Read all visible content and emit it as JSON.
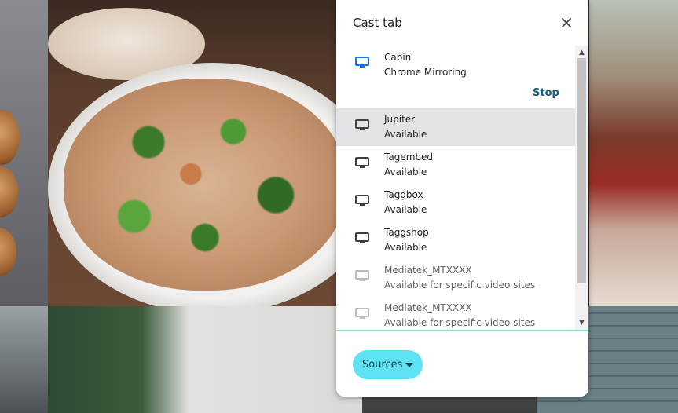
{
  "dialog": {
    "title": "Cast tab",
    "close_icon": "close-icon",
    "active_sink": {
      "name": "Cabin",
      "status": "Chrome Mirroring",
      "icon": "cast-screen-icon",
      "icon_color": "#1a73e8",
      "stop_label": "Stop"
    },
    "sinks": [
      {
        "name": "Jupiter",
        "status": "Available",
        "icon": "tv-icon",
        "highlighted": true
      },
      {
        "name": "Tagembed",
        "status": "Available",
        "icon": "tv-icon"
      },
      {
        "name": "Taggbox",
        "status": "Available",
        "icon": "tv-icon"
      },
      {
        "name": "Taggshop",
        "status": "Available",
        "icon": "tv-icon"
      },
      {
        "name": "Mediatek_MTXXXX",
        "status": "Available for specific video sites",
        "icon": "tv-icon",
        "dimmed": true
      },
      {
        "name": "Mediatek_MTXXXX",
        "status": "Available for specific video sites",
        "icon": "tv-icon",
        "dimmed": true
      }
    ],
    "sources_label": "Sources",
    "sources_caret": "caret-down-icon",
    "accent_color": "#5ee3f5"
  }
}
